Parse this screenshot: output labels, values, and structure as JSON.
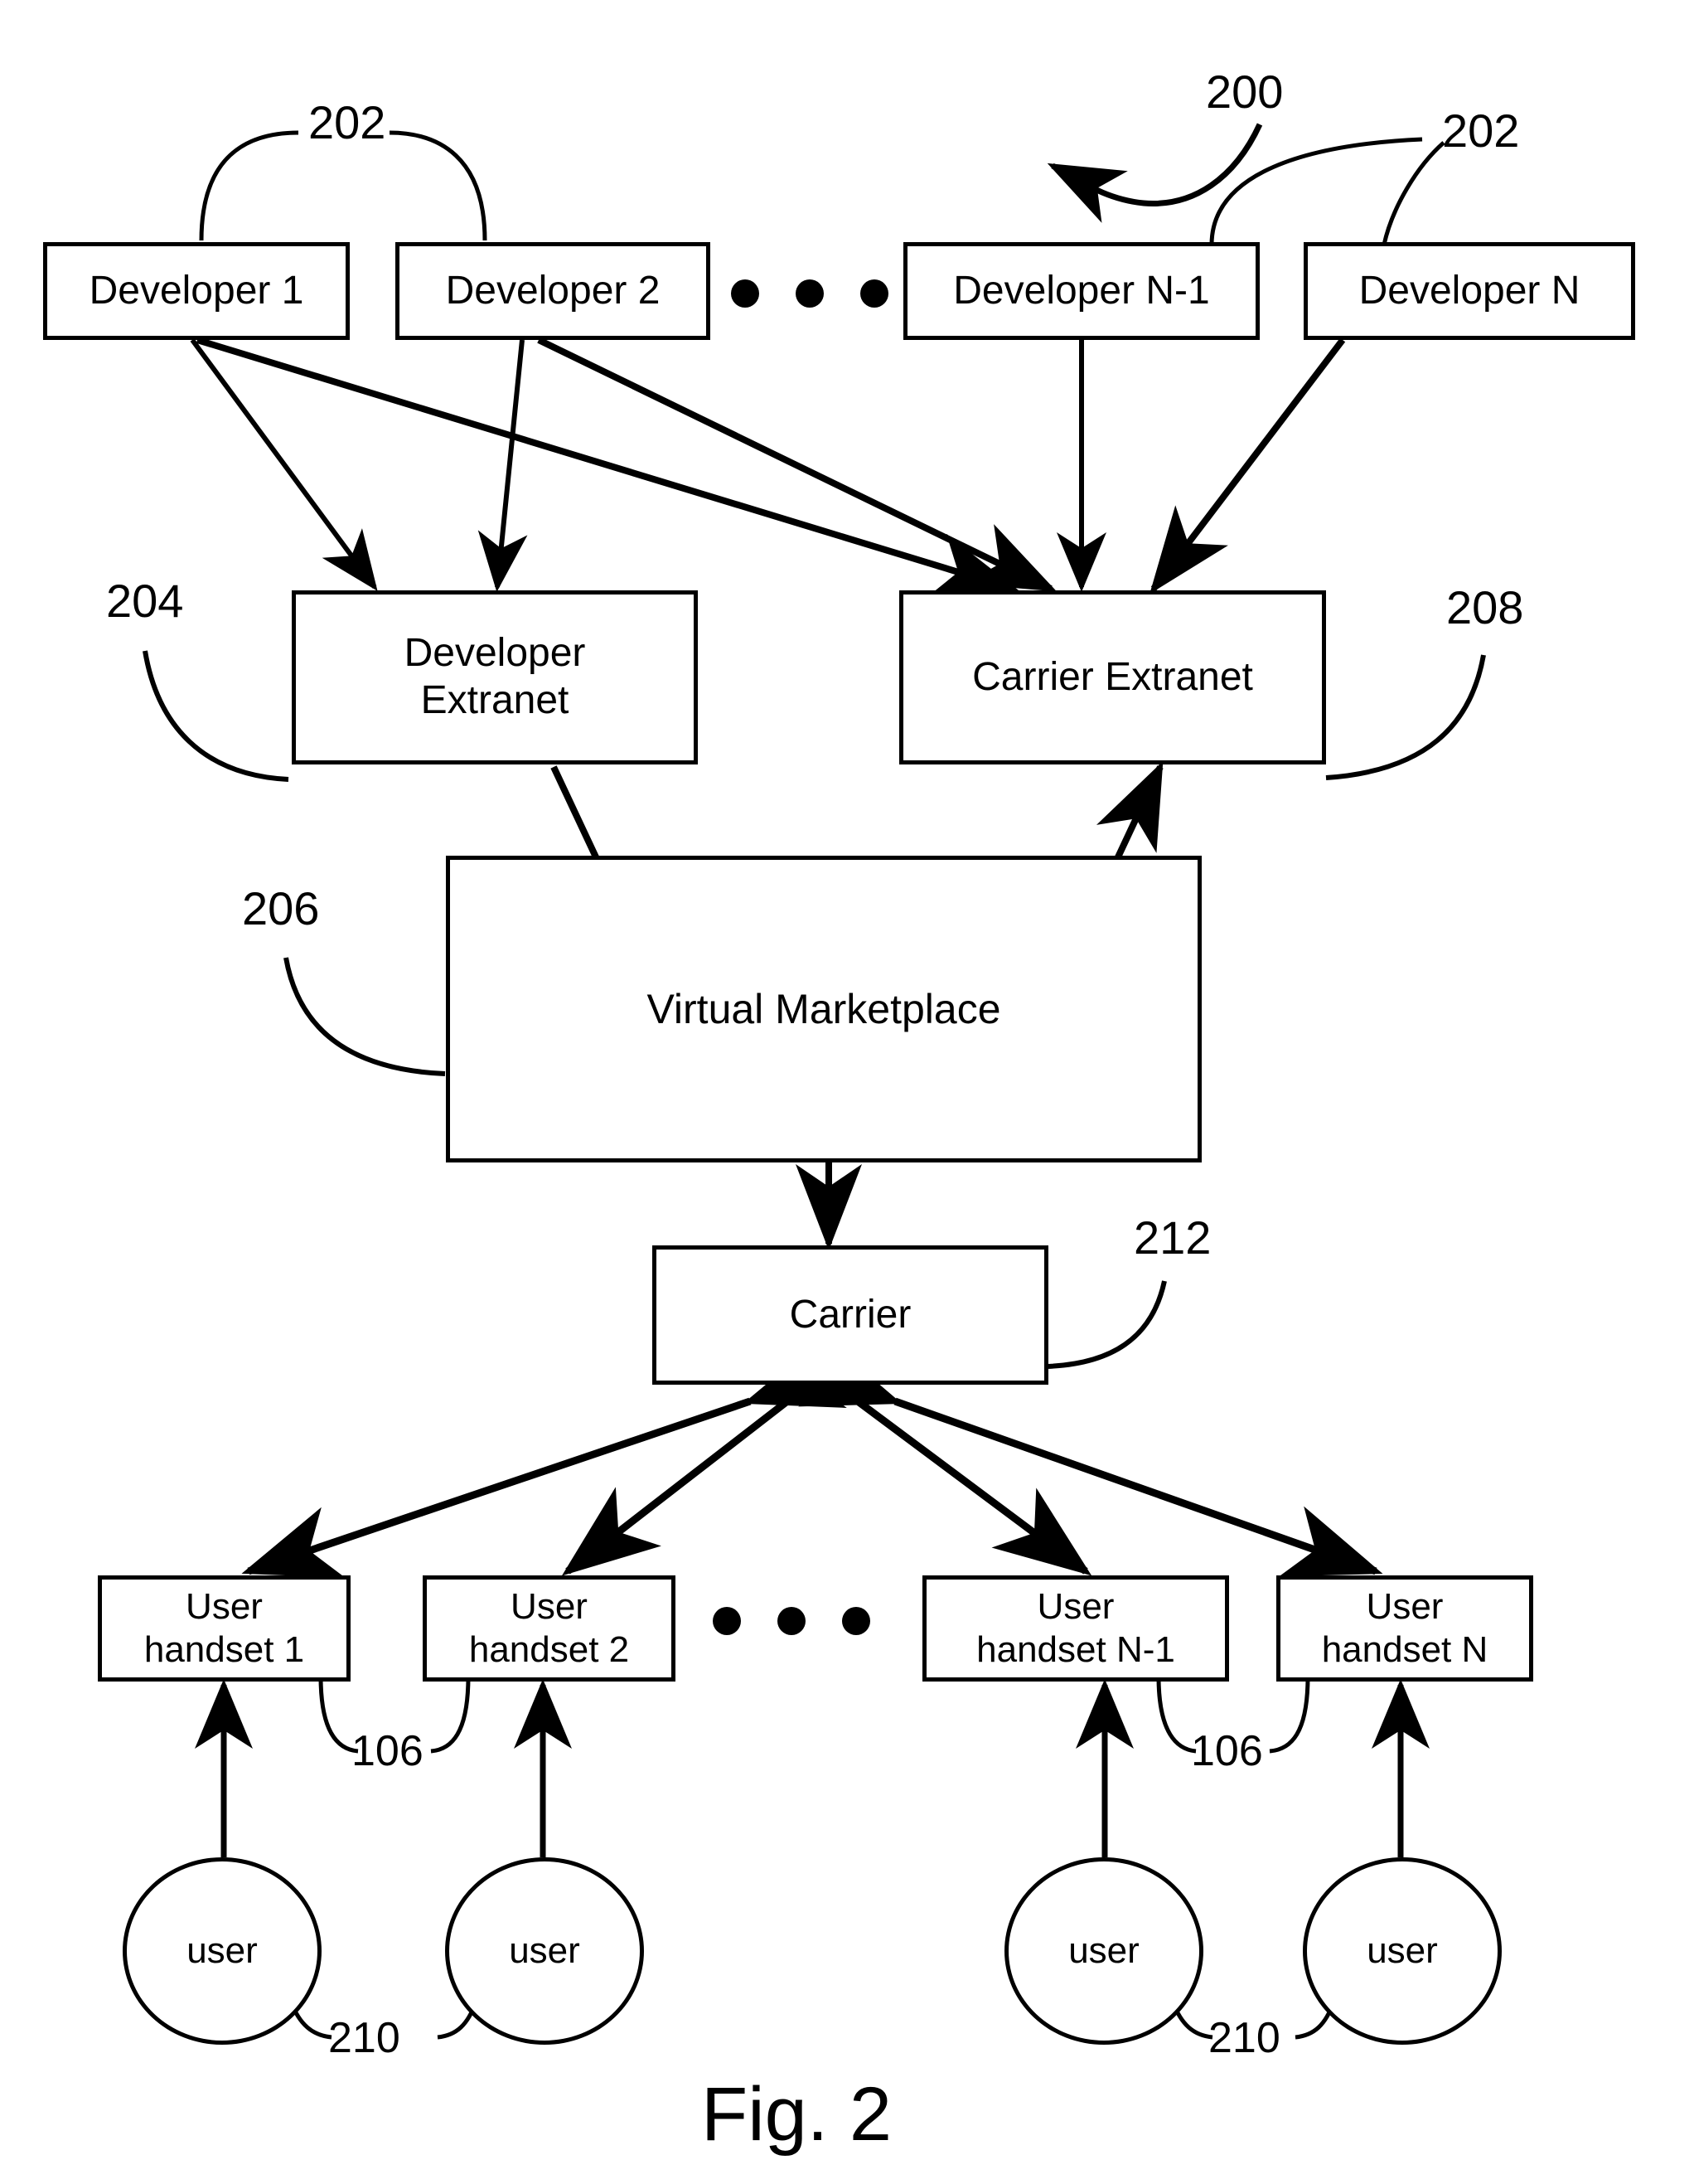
{
  "figure": {
    "caption": "Fig. 2",
    "system_ref": "200"
  },
  "nodes": {
    "developers": [
      {
        "label": "Developer 1"
      },
      {
        "label": "Developer 2"
      },
      {
        "label": "Developer N-1"
      },
      {
        "label": "Developer N"
      }
    ],
    "developer_extranet": {
      "line1": "Developer",
      "line2": "Extranet"
    },
    "carrier_extranet": {
      "label": "Carrier Extranet"
    },
    "virtual_marketplace": {
      "label": "Virtual Marketplace"
    },
    "carrier": {
      "label": "Carrier"
    },
    "handsets": [
      {
        "line1": "User",
        "line2": "handset 1"
      },
      {
        "line1": "User",
        "line2": "handset 2"
      },
      {
        "line1": "User",
        "line2": "handset N-1"
      },
      {
        "line1": "User",
        "line2": "handset N"
      }
    ],
    "users": [
      {
        "label": "user"
      },
      {
        "label": "user"
      },
      {
        "label": "user"
      },
      {
        "label": "user"
      }
    ]
  },
  "reference_numerals": {
    "developers_left": "202",
    "developers_right": "202",
    "system": "200",
    "developer_extranet": "204",
    "carrier_extranet": "208",
    "virtual_marketplace": "206",
    "carrier": "212",
    "handsets_left": "106",
    "handsets_right": "106",
    "users_left": "210",
    "users_right": "210"
  },
  "colors": {
    "stroke": "#000000",
    "background": "#ffffff"
  },
  "chart_data": {
    "type": "diagram",
    "title": "Fig. 2",
    "nodes": [
      "Developer 1",
      "Developer 2",
      "Developer N-1",
      "Developer N",
      "Developer Extranet",
      "Carrier Extranet",
      "Virtual Marketplace",
      "Carrier",
      "User handset 1",
      "User handset 2",
      "User handset N-1",
      "User handset N",
      "user",
      "user",
      "user",
      "user"
    ],
    "edges": [
      {
        "from": "Developer 1",
        "to": "Developer Extranet",
        "direction": "one-way"
      },
      {
        "from": "Developer 1",
        "to": "Carrier Extranet",
        "direction": "one-way"
      },
      {
        "from": "Developer 2",
        "to": "Developer Extranet",
        "direction": "one-way"
      },
      {
        "from": "Developer 2",
        "to": "Carrier Extranet",
        "direction": "one-way"
      },
      {
        "from": "Developer N-1",
        "to": "Carrier Extranet",
        "direction": "one-way"
      },
      {
        "from": "Developer N",
        "to": "Carrier Extranet",
        "direction": "one-way"
      },
      {
        "from": "Developer Extranet",
        "to": "Virtual Marketplace",
        "direction": "one-way"
      },
      {
        "from": "Carrier Extranet",
        "to": "Virtual Marketplace",
        "direction": "two-way"
      },
      {
        "from": "Virtual Marketplace",
        "to": "Carrier",
        "direction": "two-way"
      },
      {
        "from": "Carrier",
        "to": "User handset 1",
        "direction": "two-way"
      },
      {
        "from": "Carrier",
        "to": "User handset 2",
        "direction": "two-way"
      },
      {
        "from": "Carrier",
        "to": "User handset N-1",
        "direction": "two-way"
      },
      {
        "from": "Carrier",
        "to": "User handset N",
        "direction": "two-way"
      },
      {
        "from": "user",
        "to": "User handset 1",
        "direction": "one-way"
      },
      {
        "from": "user",
        "to": "User handset 2",
        "direction": "one-way"
      },
      {
        "from": "user",
        "to": "User handset N-1",
        "direction": "one-way"
      },
      {
        "from": "user",
        "to": "User handset N",
        "direction": "one-way"
      }
    ]
  }
}
